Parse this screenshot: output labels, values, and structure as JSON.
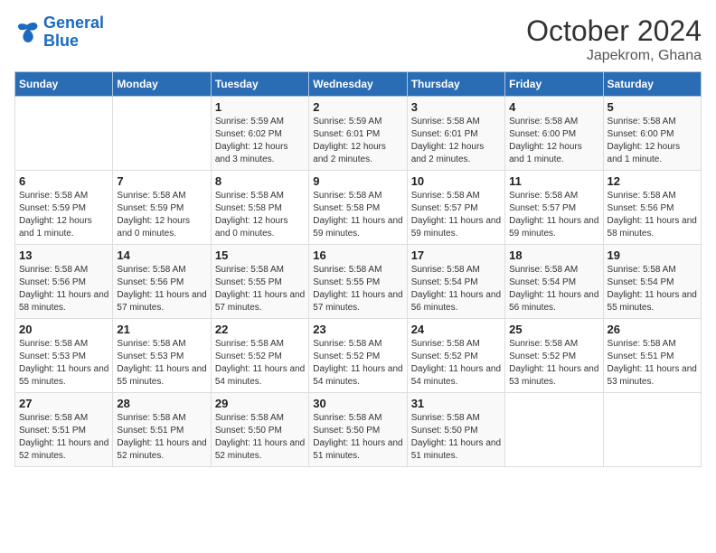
{
  "logo": {
    "text_general": "General",
    "text_blue": "Blue"
  },
  "header": {
    "month": "October 2024",
    "location": "Japekrom, Ghana"
  },
  "days_of_week": [
    "Sunday",
    "Monday",
    "Tuesday",
    "Wednesday",
    "Thursday",
    "Friday",
    "Saturday"
  ],
  "weeks": [
    [
      {
        "day": "",
        "info": ""
      },
      {
        "day": "",
        "info": ""
      },
      {
        "day": "1",
        "info": "Sunrise: 5:59 AM\nSunset: 6:02 PM\nDaylight: 12 hours and 3 minutes."
      },
      {
        "day": "2",
        "info": "Sunrise: 5:59 AM\nSunset: 6:01 PM\nDaylight: 12 hours and 2 minutes."
      },
      {
        "day": "3",
        "info": "Sunrise: 5:58 AM\nSunset: 6:01 PM\nDaylight: 12 hours and 2 minutes."
      },
      {
        "day": "4",
        "info": "Sunrise: 5:58 AM\nSunset: 6:00 PM\nDaylight: 12 hours and 1 minute."
      },
      {
        "day": "5",
        "info": "Sunrise: 5:58 AM\nSunset: 6:00 PM\nDaylight: 12 hours and 1 minute."
      }
    ],
    [
      {
        "day": "6",
        "info": "Sunrise: 5:58 AM\nSunset: 5:59 PM\nDaylight: 12 hours and 1 minute."
      },
      {
        "day": "7",
        "info": "Sunrise: 5:58 AM\nSunset: 5:59 PM\nDaylight: 12 hours and 0 minutes."
      },
      {
        "day": "8",
        "info": "Sunrise: 5:58 AM\nSunset: 5:58 PM\nDaylight: 12 hours and 0 minutes."
      },
      {
        "day": "9",
        "info": "Sunrise: 5:58 AM\nSunset: 5:58 PM\nDaylight: 11 hours and 59 minutes."
      },
      {
        "day": "10",
        "info": "Sunrise: 5:58 AM\nSunset: 5:57 PM\nDaylight: 11 hours and 59 minutes."
      },
      {
        "day": "11",
        "info": "Sunrise: 5:58 AM\nSunset: 5:57 PM\nDaylight: 11 hours and 59 minutes."
      },
      {
        "day": "12",
        "info": "Sunrise: 5:58 AM\nSunset: 5:56 PM\nDaylight: 11 hours and 58 minutes."
      }
    ],
    [
      {
        "day": "13",
        "info": "Sunrise: 5:58 AM\nSunset: 5:56 PM\nDaylight: 11 hours and 58 minutes."
      },
      {
        "day": "14",
        "info": "Sunrise: 5:58 AM\nSunset: 5:56 PM\nDaylight: 11 hours and 57 minutes."
      },
      {
        "day": "15",
        "info": "Sunrise: 5:58 AM\nSunset: 5:55 PM\nDaylight: 11 hours and 57 minutes."
      },
      {
        "day": "16",
        "info": "Sunrise: 5:58 AM\nSunset: 5:55 PM\nDaylight: 11 hours and 57 minutes."
      },
      {
        "day": "17",
        "info": "Sunrise: 5:58 AM\nSunset: 5:54 PM\nDaylight: 11 hours and 56 minutes."
      },
      {
        "day": "18",
        "info": "Sunrise: 5:58 AM\nSunset: 5:54 PM\nDaylight: 11 hours and 56 minutes."
      },
      {
        "day": "19",
        "info": "Sunrise: 5:58 AM\nSunset: 5:54 PM\nDaylight: 11 hours and 55 minutes."
      }
    ],
    [
      {
        "day": "20",
        "info": "Sunrise: 5:58 AM\nSunset: 5:53 PM\nDaylight: 11 hours and 55 minutes."
      },
      {
        "day": "21",
        "info": "Sunrise: 5:58 AM\nSunset: 5:53 PM\nDaylight: 11 hours and 55 minutes."
      },
      {
        "day": "22",
        "info": "Sunrise: 5:58 AM\nSunset: 5:52 PM\nDaylight: 11 hours and 54 minutes."
      },
      {
        "day": "23",
        "info": "Sunrise: 5:58 AM\nSunset: 5:52 PM\nDaylight: 11 hours and 54 minutes."
      },
      {
        "day": "24",
        "info": "Sunrise: 5:58 AM\nSunset: 5:52 PM\nDaylight: 11 hours and 54 minutes."
      },
      {
        "day": "25",
        "info": "Sunrise: 5:58 AM\nSunset: 5:52 PM\nDaylight: 11 hours and 53 minutes."
      },
      {
        "day": "26",
        "info": "Sunrise: 5:58 AM\nSunset: 5:51 PM\nDaylight: 11 hours and 53 minutes."
      }
    ],
    [
      {
        "day": "27",
        "info": "Sunrise: 5:58 AM\nSunset: 5:51 PM\nDaylight: 11 hours and 52 minutes."
      },
      {
        "day": "28",
        "info": "Sunrise: 5:58 AM\nSunset: 5:51 PM\nDaylight: 11 hours and 52 minutes."
      },
      {
        "day": "29",
        "info": "Sunrise: 5:58 AM\nSunset: 5:50 PM\nDaylight: 11 hours and 52 minutes."
      },
      {
        "day": "30",
        "info": "Sunrise: 5:58 AM\nSunset: 5:50 PM\nDaylight: 11 hours and 51 minutes."
      },
      {
        "day": "31",
        "info": "Sunrise: 5:58 AM\nSunset: 5:50 PM\nDaylight: 11 hours and 51 minutes."
      },
      {
        "day": "",
        "info": ""
      },
      {
        "day": "",
        "info": ""
      }
    ]
  ]
}
